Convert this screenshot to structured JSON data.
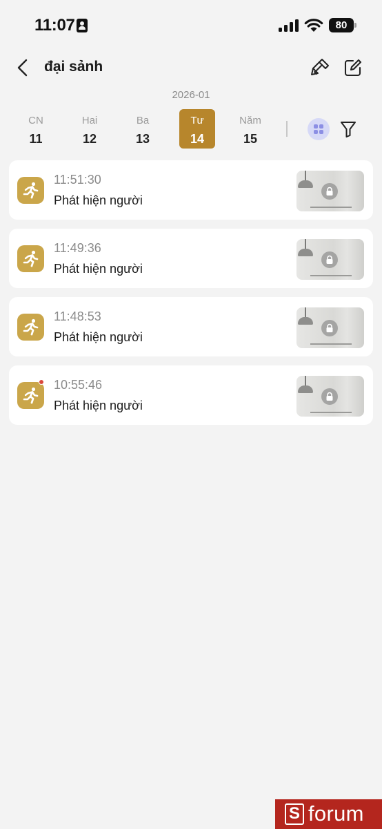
{
  "status_bar": {
    "time": "11:07",
    "battery": "80"
  },
  "header": {
    "title": "đại sảnh",
    "icons": [
      "back-chevron-icon",
      "clean-brush-icon",
      "edit-icon"
    ]
  },
  "calendar": {
    "month": "2026-01",
    "days": [
      {
        "name": "CN",
        "num": "11"
      },
      {
        "name": "Hai",
        "num": "12"
      },
      {
        "name": "Ba",
        "num": "13"
      },
      {
        "name": "Tư",
        "num": "14",
        "active": true
      },
      {
        "name": "Năm",
        "num": "15"
      }
    ],
    "active_color": "#b7862c"
  },
  "events": [
    {
      "time": "11:51:30",
      "title": "Phát hiện người",
      "unread": false
    },
    {
      "time": "11:49:36",
      "title": "Phát hiện người",
      "unread": false
    },
    {
      "time": "11:48:53",
      "title": "Phát hiện người",
      "unread": false
    },
    {
      "time": "10:55:46",
      "title": "Phát hiện người",
      "unread": true
    }
  ],
  "colors": {
    "event_icon": "#caa64a",
    "unread_dot": "#d9473b",
    "watermark_bg": "#b4261e"
  },
  "watermark": {
    "logo": "S",
    "text": "forum"
  }
}
